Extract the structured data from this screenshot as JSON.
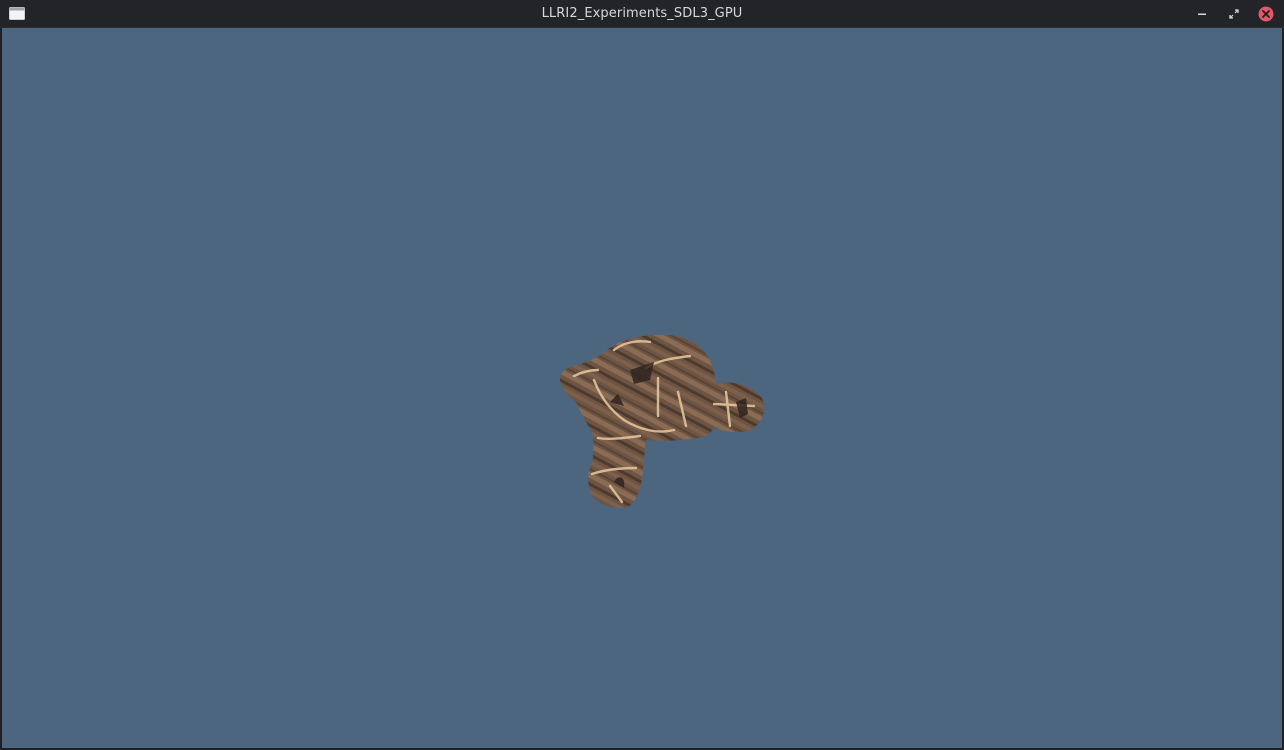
{
  "window": {
    "title": "LLRI2_Experiments_SDL3_GPU",
    "controls": [
      "minimize-icon",
      "restore-icon",
      "close-icon"
    ]
  },
  "viewport": {
    "clear_color": "#4d6680",
    "object": "textured-suzanne-monkey-head"
  },
  "colors": {
    "titlebar": "#222427",
    "title_text": "#d6d8db",
    "close_button": "#e0566a"
  }
}
